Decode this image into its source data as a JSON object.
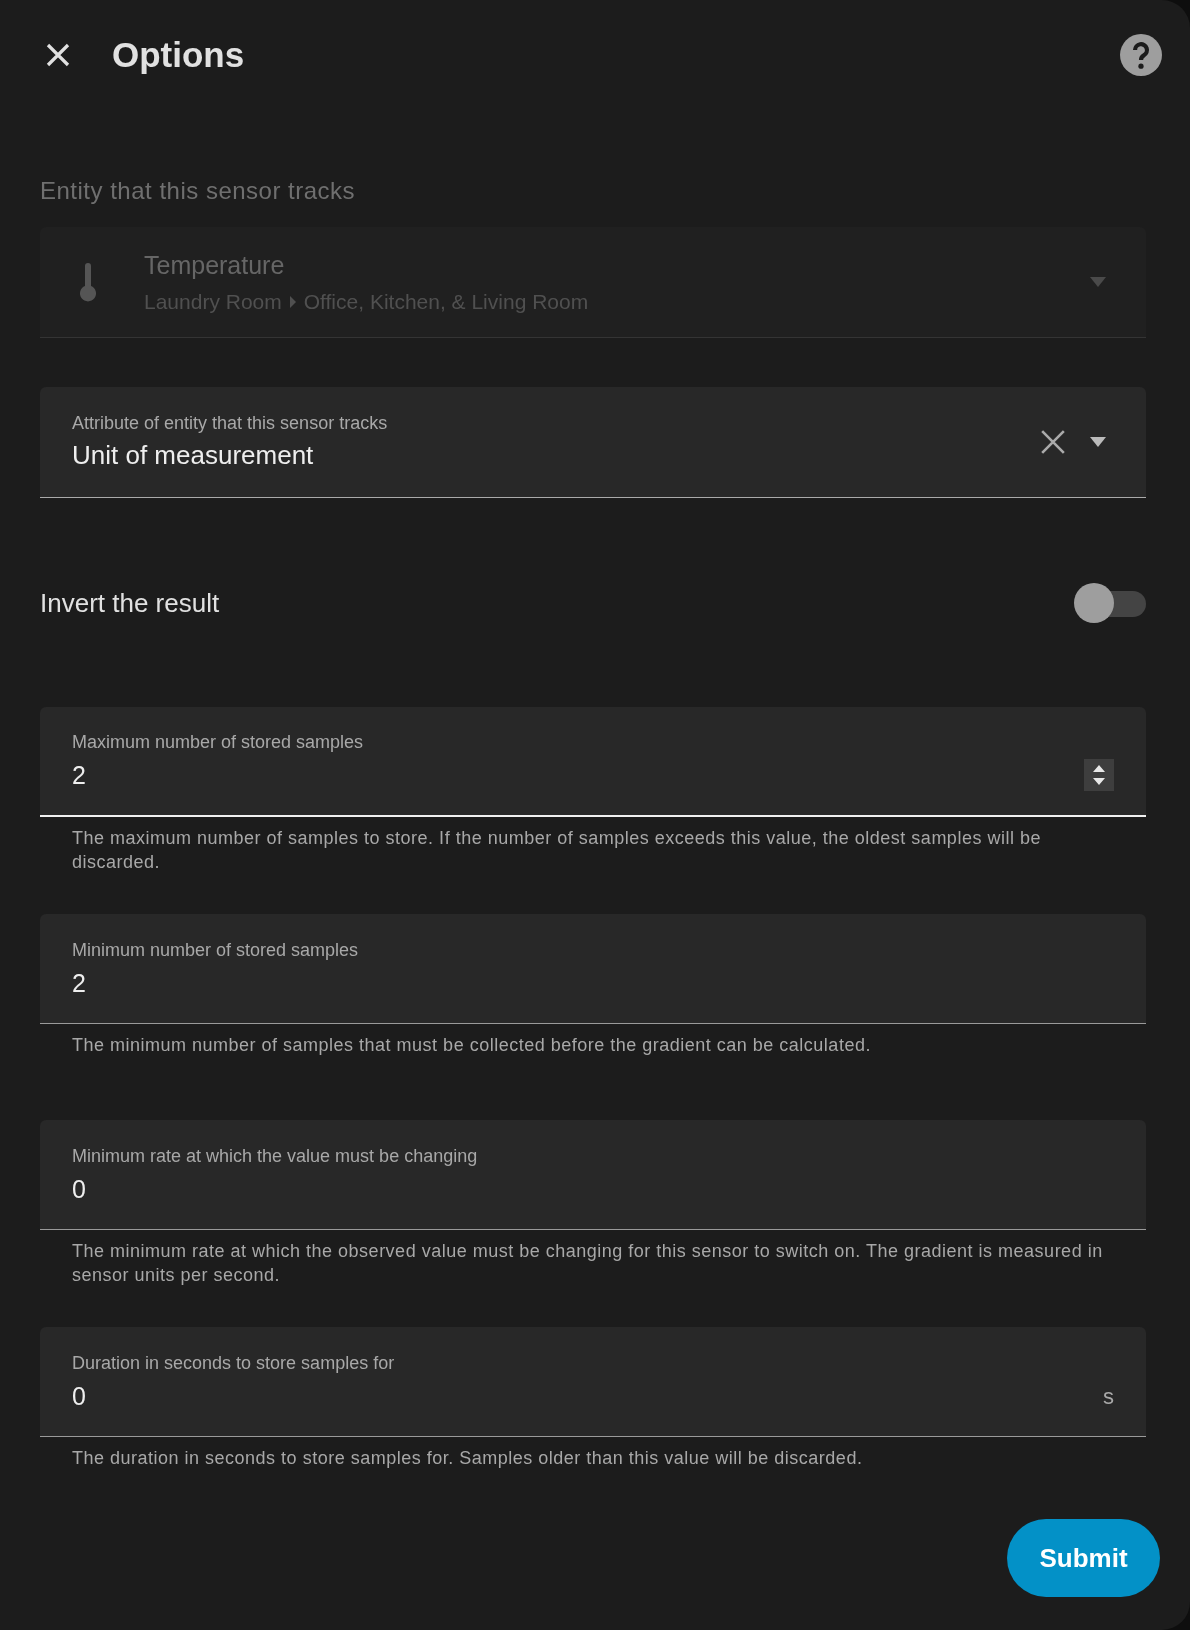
{
  "dialog": {
    "title": "Options"
  },
  "entity_picker": {
    "label": "Entity that this sensor tracks",
    "name": "Temperature",
    "area": "Laundry Room",
    "context": "Office, Kitchen, & Living Room",
    "disabled": true
  },
  "attribute_select": {
    "label": "Attribute of entity that this sensor tracks",
    "value": "Unit of measurement"
  },
  "toggle": {
    "label": "Invert the result",
    "on": false
  },
  "fields": [
    {
      "kind": "number",
      "label": "Maximum number of stored samples",
      "value": "2",
      "focused": true,
      "helper": "The maximum number of samples to store. If the number of samples exceeds this value, the oldest samples will be discarded."
    },
    {
      "kind": "plain",
      "label": "Minimum number of stored samples",
      "value": "2",
      "focused": false,
      "helper": "The minimum number of samples that must be collected before the gradient can be calculated."
    },
    {
      "kind": "plain",
      "label": "Minimum rate at which the value must be changing",
      "value": "0",
      "focused": false,
      "helper": "The minimum rate at which the observed value must be changing for this sensor to switch on. The gradient is measured in sensor units per second."
    },
    {
      "kind": "suffix",
      "label": "Duration in seconds to store samples for",
      "value": "0",
      "suffix": "s",
      "focused": false,
      "helper": "The duration in seconds to store samples for. Samples older than this value will be discarded."
    }
  ],
  "submit": "Submit"
}
